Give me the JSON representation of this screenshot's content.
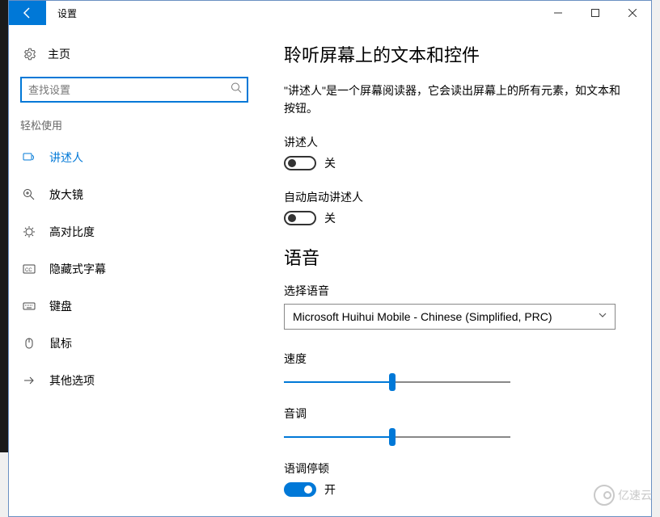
{
  "window": {
    "title": "设置"
  },
  "sidebar": {
    "home_label": "主页",
    "search_placeholder": "查找设置",
    "category": "轻松使用",
    "items": [
      {
        "icon": "narrator-icon",
        "label": "讲述人",
        "active": true
      },
      {
        "icon": "magnifier-icon",
        "label": "放大镜",
        "active": false
      },
      {
        "icon": "contrast-icon",
        "label": "高对比度",
        "active": false
      },
      {
        "icon": "cc-icon",
        "label": "隐藏式字幕",
        "active": false
      },
      {
        "icon": "keyboard-icon",
        "label": "键盘",
        "active": false
      },
      {
        "icon": "mouse-icon",
        "label": "鼠标",
        "active": false
      },
      {
        "icon": "arrow-icon",
        "label": "其他选项",
        "active": false
      }
    ]
  },
  "content": {
    "heading": "聆听屏幕上的文本和控件",
    "description": "\"讲述人\"是一个屏幕阅读器，它会读出屏幕上的所有元素，如文本和按钮。",
    "narrator_label": "讲述人",
    "narrator_state": "关",
    "autostart_label": "自动启动讲述人",
    "autostart_state": "关",
    "voice_heading": "语音",
    "select_label": "选择语音",
    "select_value": "Microsoft Huihui Mobile - Chinese (Simplified, PRC)",
    "speed_label": "速度",
    "speed_value": 48,
    "pitch_label": "音调",
    "pitch_value": 48,
    "pause_label": "语调停顿",
    "pause_state": "开"
  },
  "watermark": "亿速云"
}
